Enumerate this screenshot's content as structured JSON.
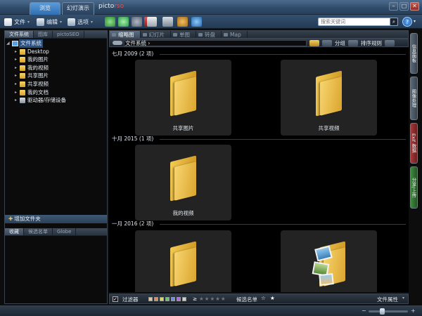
{
  "titlebar": {
    "tabs": [
      {
        "label": "浏览",
        "active": true
      },
      {
        "label": "幻灯演示",
        "active": false
      }
    ],
    "logo_main": "picto",
    "logo_accent": "rso"
  },
  "toolbar": {
    "menus": [
      {
        "label": "文件",
        "icon": "file-icon"
      },
      {
        "label": "编辑",
        "icon": "edit-icon"
      },
      {
        "label": "选项",
        "icon": "options-icon"
      }
    ],
    "search_placeholder": "搜索关键词",
    "help_label": "?"
  },
  "left_panel": {
    "tabs": [
      "文件系统",
      "图库",
      "pictoSEO"
    ],
    "tree_root": "文件系统",
    "tree_items": [
      "Desktop",
      "我的图片",
      "我的视频",
      "共享图片",
      "共享视频",
      "我的文档",
      "驱动器/存储设备"
    ],
    "add_folder_label": "增加文件夹",
    "bottom_tabs": [
      "收藏",
      "候选名单",
      "Globe"
    ]
  },
  "view_tabs": [
    {
      "label": "缩略图",
      "active": true
    },
    {
      "label": "幻灯片",
      "active": false
    },
    {
      "label": "单图",
      "active": false
    },
    {
      "label": "转盘",
      "active": false
    },
    {
      "label": "Map",
      "active": false
    }
  ],
  "pathbar": {
    "path": "文件系统 ›",
    "group_label": "分组",
    "sort_label": "排序规则"
  },
  "groups": [
    {
      "header": "七月 2009 (2 项)",
      "items": [
        "共享图片",
        "共享视频"
      ]
    },
    {
      "header": "十月 2015 (1 项)",
      "items": [
        "我的视频"
      ]
    },
    {
      "header": "一月 2016 (2 项)",
      "items": [
        "",
        ""
      ]
    }
  ],
  "right_sidebar": {
    "tabs": [
      {
        "label": "信息面板",
        "color": "#4a5868"
      },
      {
        "label": "图像处理",
        "color": "#4a5868"
      },
      {
        "label": "Exif 数据",
        "color": "#8a2b2b"
      },
      {
        "label": "分享/上传",
        "color": "#2d6a2d"
      }
    ]
  },
  "filterbar": {
    "filter_label": "过滤器",
    "rating_prefix": "≥",
    "shortlist_label": "候选名单",
    "file_props_label": "文件属性",
    "color_swatches": [
      "#d9c7a3",
      "#e08a5a",
      "#d8d85a",
      "#6ac46a",
      "#6a8fe0",
      "#b06ae0",
      "#cfcfcf"
    ]
  },
  "statusbar": {
    "zoom_minus": "−",
    "zoom_plus": "+"
  }
}
